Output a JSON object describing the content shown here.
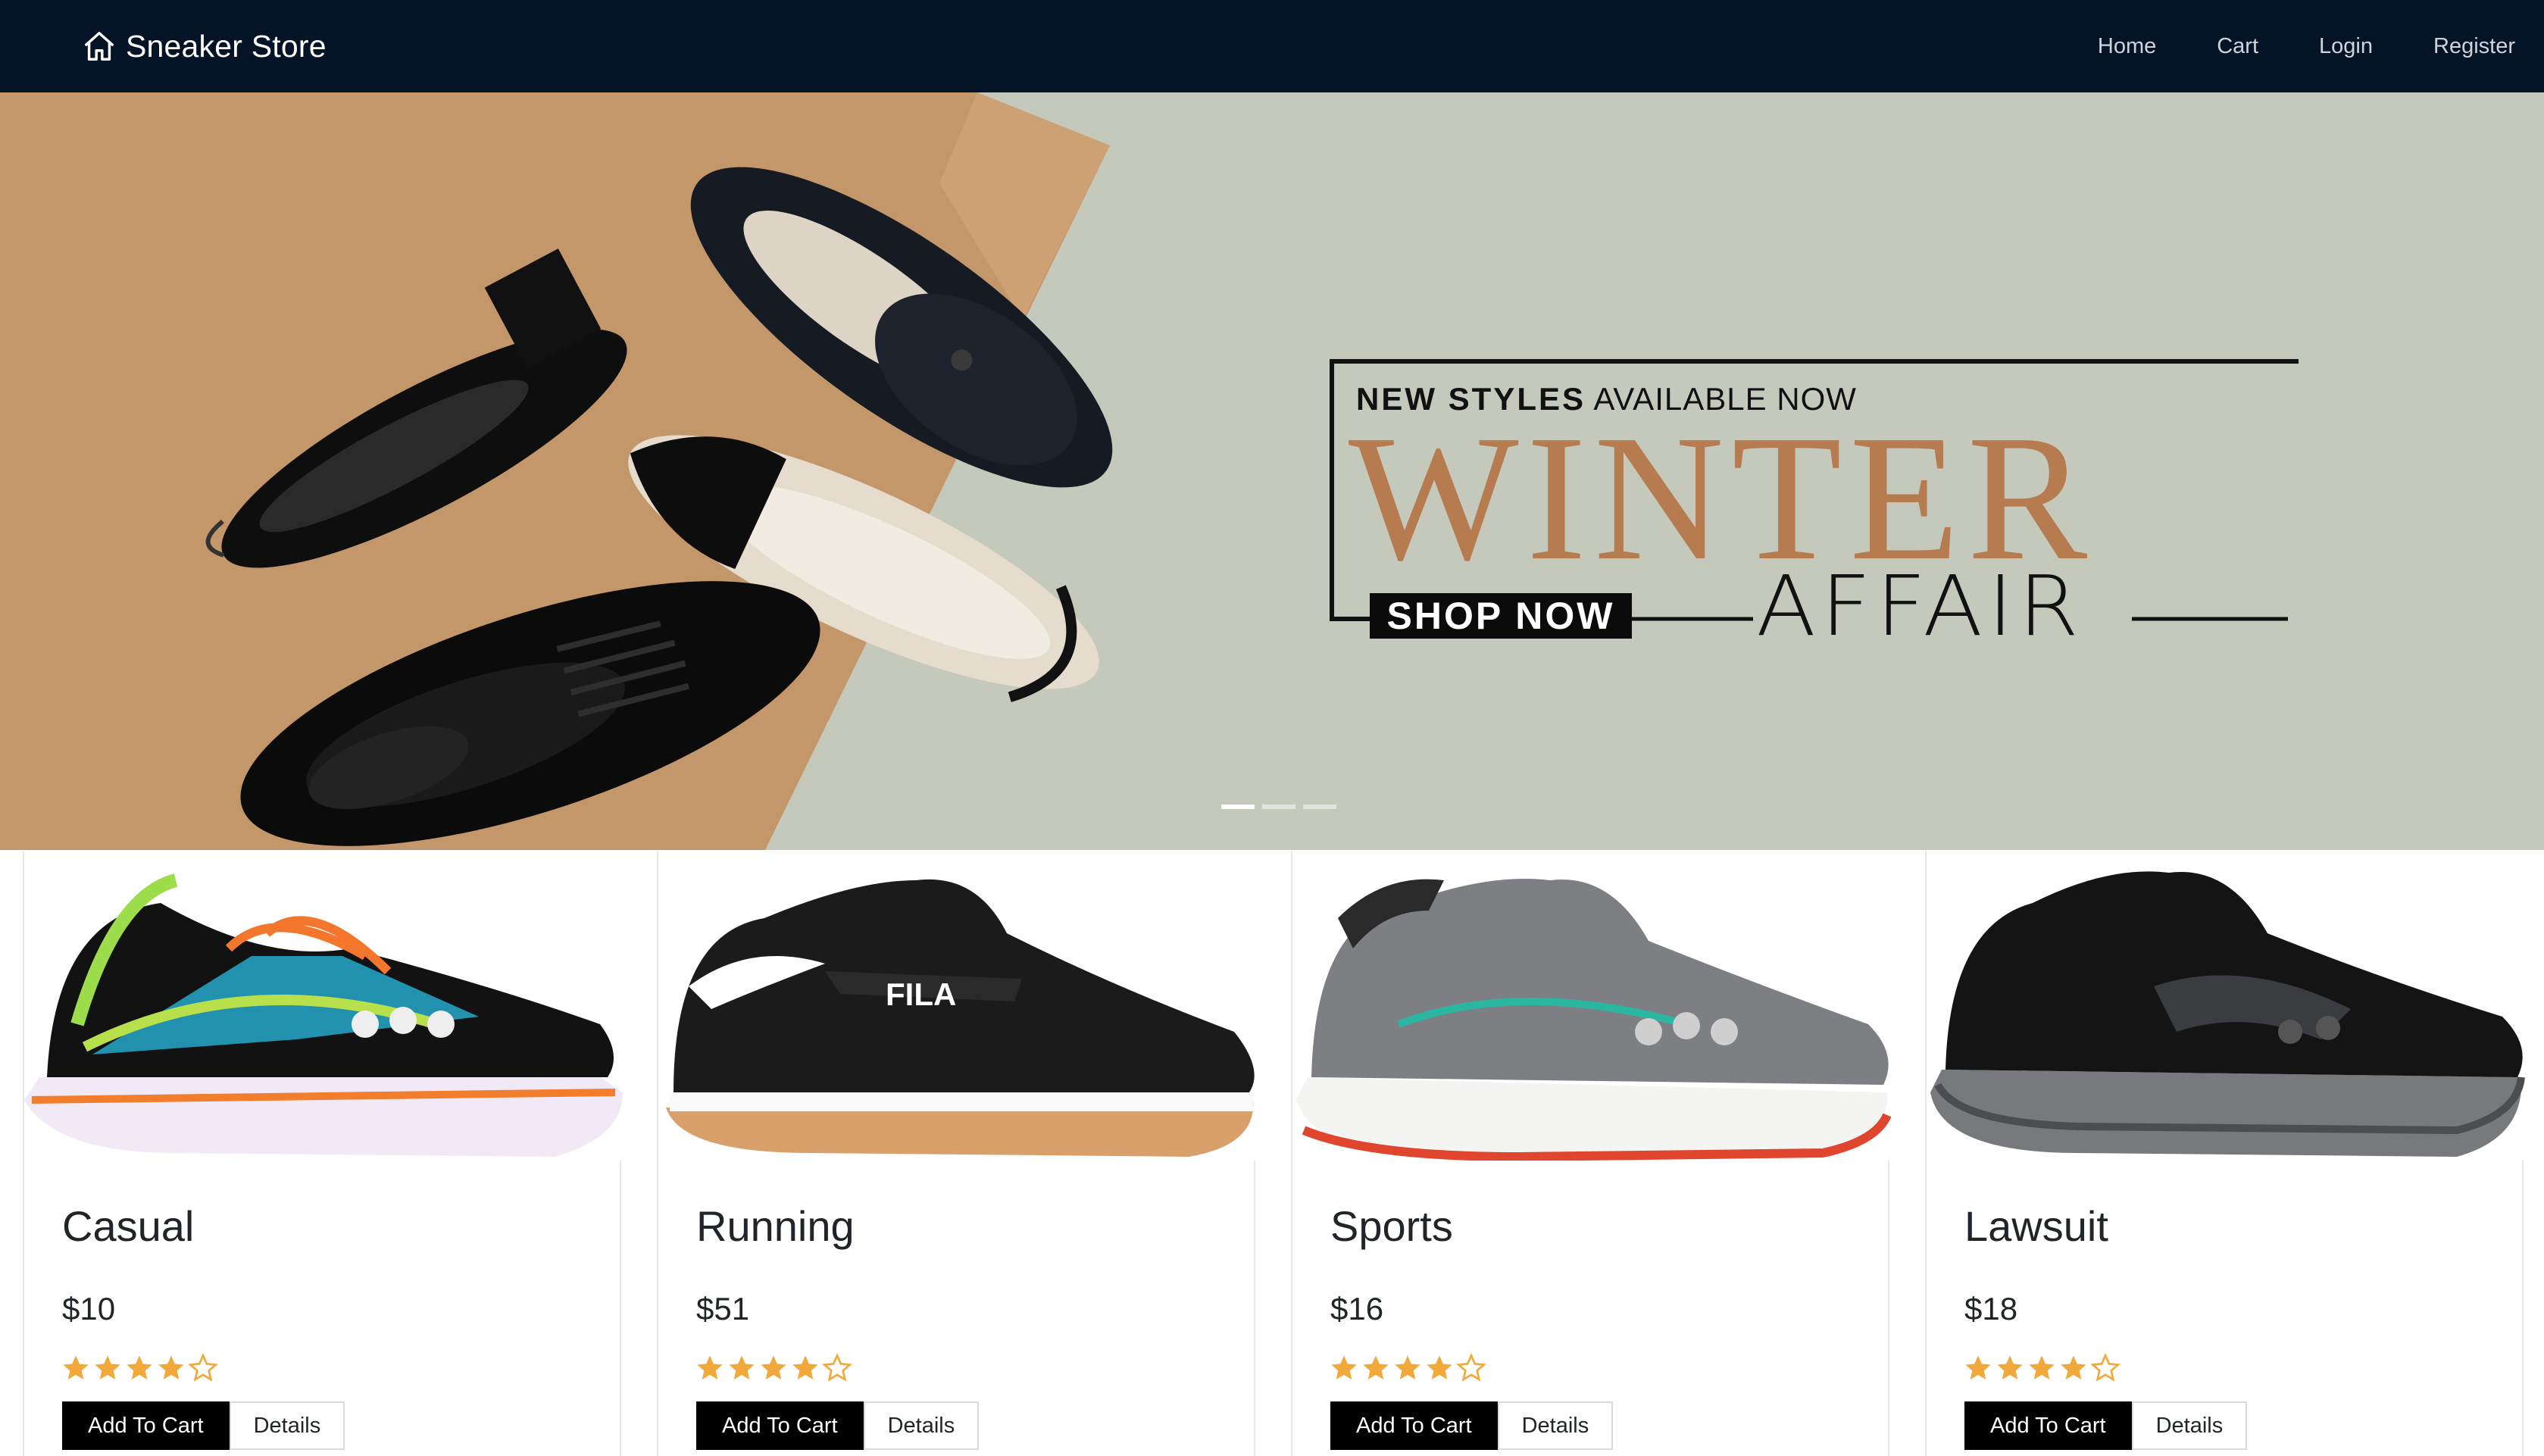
{
  "navbar": {
    "brand": "Sneaker Store",
    "brand_icon": "home-icon",
    "links": [
      "Home",
      "Cart",
      "Login",
      "Register"
    ]
  },
  "hero": {
    "subtitle_bold": "NEW STYLES",
    "subtitle_rest": "AVAILABLE NOW",
    "title": "WINTER",
    "title_second": "AFFAIR",
    "cta": "SHOP NOW",
    "slide_count": 3,
    "active_slide": 1,
    "colors": {
      "background": "#c5c9bc",
      "kraft": "#c4976b",
      "title": "#b67c50"
    }
  },
  "products": [
    {
      "title": "Casual",
      "price": "$10",
      "rating": 4,
      "rating_max": 5,
      "add_label": "Add To Cart",
      "details_label": "Details"
    },
    {
      "title": "Running",
      "price": "$51",
      "rating": 4,
      "rating_max": 5,
      "add_label": "Add To Cart",
      "details_label": "Details"
    },
    {
      "title": "Sports",
      "price": "$16",
      "rating": 4,
      "rating_max": 5,
      "add_label": "Add To Cart",
      "details_label": "Details"
    },
    {
      "title": "Lawsuit",
      "price": "$18",
      "rating": 4,
      "rating_max": 5,
      "add_label": "Add To Cart",
      "details_label": "Details"
    }
  ],
  "colors": {
    "navbar": "#041326",
    "star": "#f2a93b",
    "button_primary": "#000000"
  }
}
